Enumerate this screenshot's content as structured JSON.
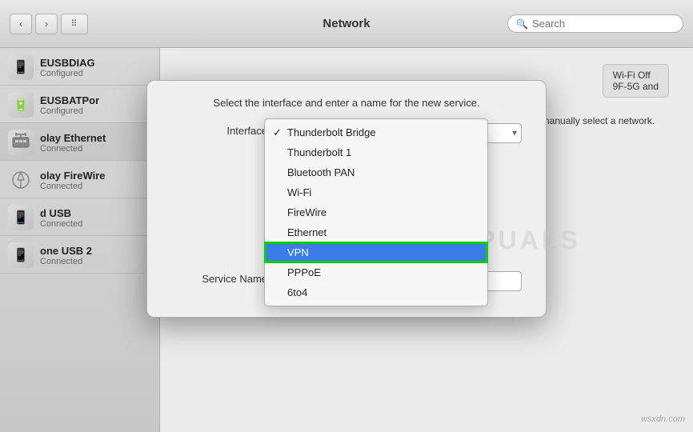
{
  "titleBar": {
    "title": "Network",
    "search_placeholder": "Search"
  },
  "sidebar": {
    "items": [
      {
        "id": "eusbdiag",
        "name": "EUSBDIAG",
        "status": "Configured",
        "icon": "📱"
      },
      {
        "id": "eusbatpor",
        "name": "EUSBATPor",
        "status": "Configured",
        "icon": "🔋"
      },
      {
        "id": "play-ethernet",
        "name": "olay Ethernet",
        "status": "Connected",
        "icon": "🖧"
      },
      {
        "id": "play-firewire",
        "name": "olay FireWire",
        "status": "Connected",
        "icon": "⚡"
      },
      {
        "id": "d-usb",
        "name": "d USB",
        "status": "Connected",
        "icon": "📱"
      },
      {
        "id": "one-usb-2",
        "name": "one USB 2",
        "status": "Connected",
        "icon": "📱"
      }
    ]
  },
  "dialog": {
    "title": "Select the interface and enter a name for the new service.",
    "interface_label": "Interface",
    "service_name_label": "Service Name",
    "dropdown_items": [
      {
        "id": "thunderbolt-bridge",
        "label": "Thunderbolt Bridge",
        "checked": true
      },
      {
        "id": "thunderbolt-1",
        "label": "Thunderbolt 1",
        "checked": false
      },
      {
        "id": "bluetooth-pan",
        "label": "Bluetooth PAN",
        "checked": false
      },
      {
        "id": "wi-fi",
        "label": "Wi-Fi",
        "checked": false
      },
      {
        "id": "firewire",
        "label": "FireWire",
        "checked": false
      },
      {
        "id": "ethernet",
        "label": "Ethernet",
        "checked": false
      },
      {
        "id": "vpn",
        "label": "VPN",
        "checked": false,
        "highlighted": true
      },
      {
        "id": "pppoe",
        "label": "PPPoE",
        "checked": false
      },
      {
        "id": "6to4",
        "label": "6to4",
        "checked": false
      }
    ]
  },
  "rightPanel": {
    "wifi_status": "Wi-Fi Off",
    "wifi_detail": "9F-5G and",
    "body_text": "you will be joined automatically. If no known networks are available, you will have to manually select a network."
  },
  "watermark": "wsxdn.com"
}
